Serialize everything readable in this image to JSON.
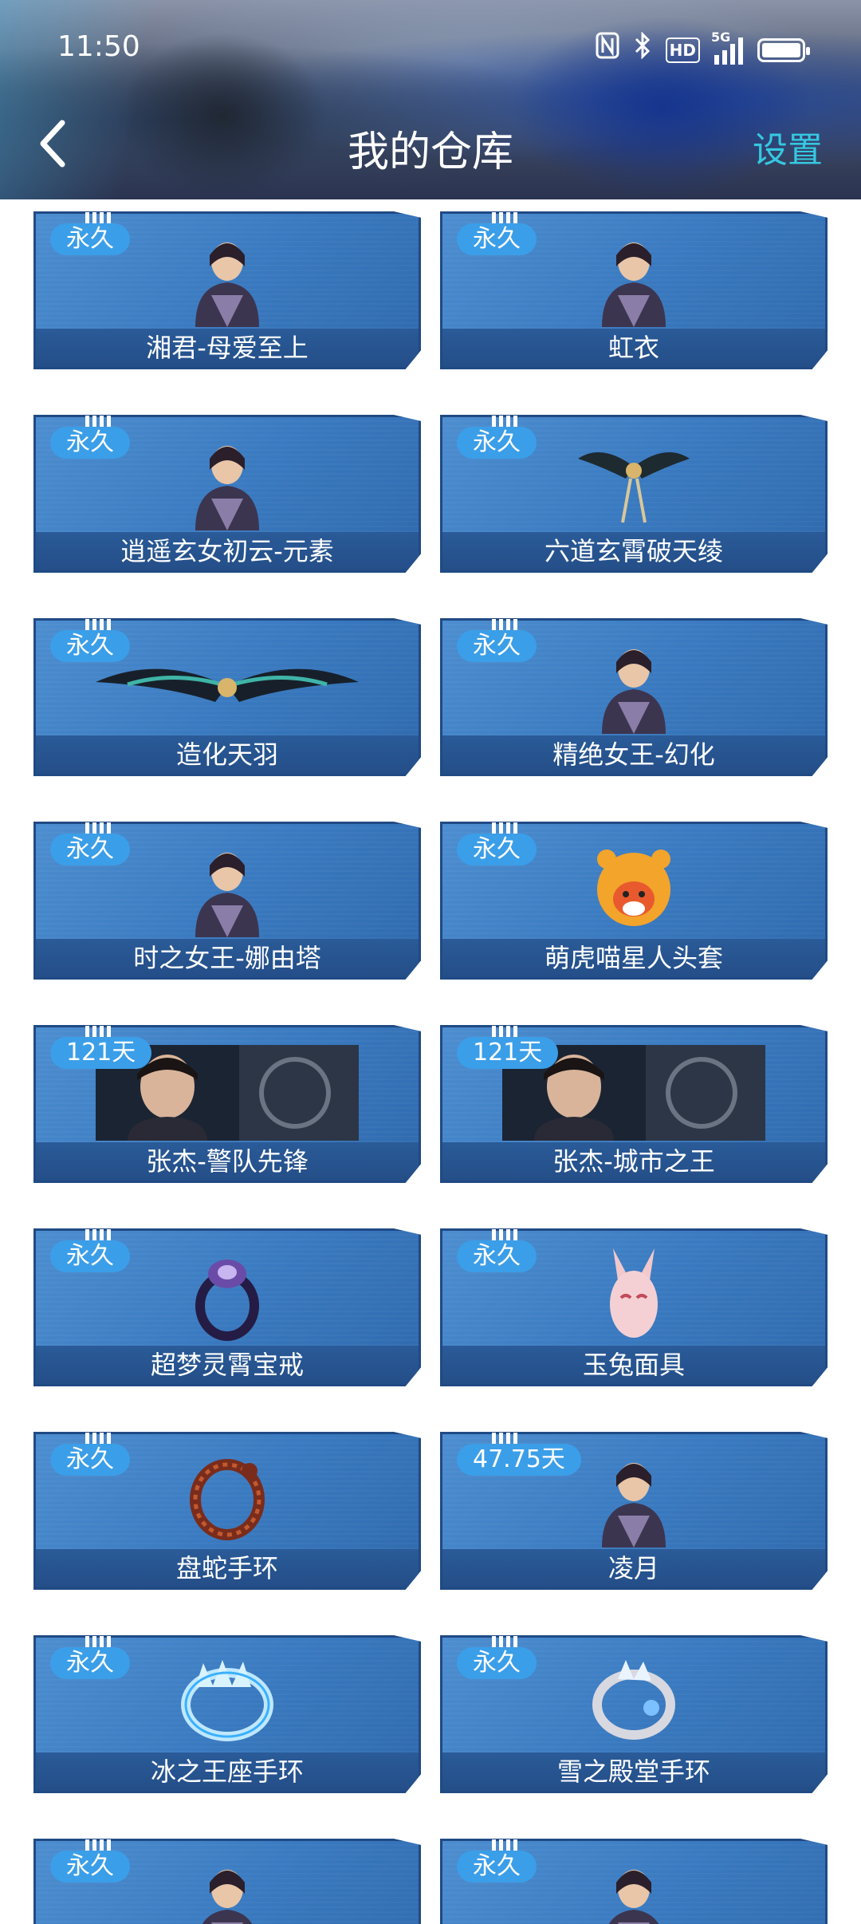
{
  "status_bar": {
    "time": "11:50",
    "icons": [
      "nfc-icon",
      "bluetooth-icon",
      "hd-icon",
      "5g-signal-icon",
      "battery-icon"
    ],
    "hd_label": "HD",
    "network_label": "5G"
  },
  "header": {
    "title": "我的仓库",
    "settings_label": "设置"
  },
  "colors": {
    "card_blue": "#3a7ac0",
    "badge_blue": "#3b9ee8",
    "settings_cyan": "#35c8e0"
  },
  "items": [
    {
      "duration": "永久",
      "name": "湘君-母爱至上",
      "image": "character-portrait"
    },
    {
      "duration": "永久",
      "name": "虹衣",
      "image": "character-portrait"
    },
    {
      "duration": "永久",
      "name": "逍遥玄女初云-元素",
      "image": "character-portrait"
    },
    {
      "duration": "永久",
      "name": "六道玄霄破天绫",
      "image": "wings-ornament"
    },
    {
      "duration": "永久",
      "name": "造化天羽",
      "image": "dragon-wings"
    },
    {
      "duration": "永久",
      "name": "精绝女王-幻化",
      "image": "character-portrait"
    },
    {
      "duration": "永久",
      "name": "时之女王-娜由塔",
      "image": "character-portrait"
    },
    {
      "duration": "永久",
      "name": "萌虎喵星人头套",
      "image": "tiger-head-helmet"
    },
    {
      "duration": "121天",
      "name": "张杰-警队先锋",
      "image": "card-banner"
    },
    {
      "duration": "121天",
      "name": "张杰-城市之王",
      "image": "card-banner"
    },
    {
      "duration": "永久",
      "name": "超梦灵霄宝戒",
      "image": "ring"
    },
    {
      "duration": "永久",
      "name": "玉兔面具",
      "image": "rabbit-mask"
    },
    {
      "duration": "永久",
      "name": "盘蛇手环",
      "image": "snake-bracelet"
    },
    {
      "duration": "47.75天",
      "name": "凌月",
      "image": "character-portrait"
    },
    {
      "duration": "永久",
      "name": "冰之王座手环",
      "image": "ice-bracelet"
    },
    {
      "duration": "永久",
      "name": "雪之殿堂手环",
      "image": "crystal-bracelet"
    },
    {
      "duration": "永久",
      "name": "",
      "image": "character-portrait"
    },
    {
      "duration": "永久",
      "name": "",
      "image": "character-portrait"
    }
  ]
}
